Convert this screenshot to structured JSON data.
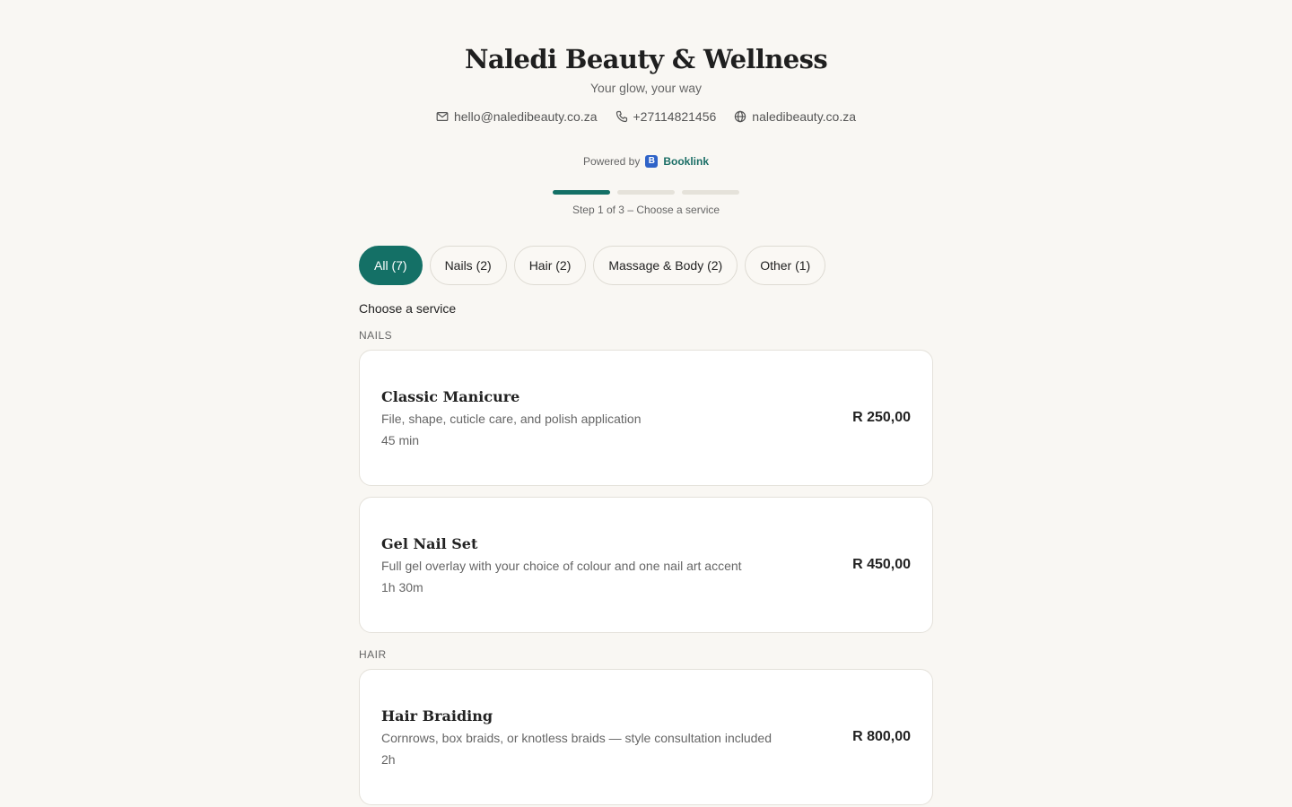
{
  "business": {
    "name": "Naledi Beauty & Wellness",
    "tagline": "Your glow, your way",
    "email": "hello@naledibeauty.co.za",
    "phone": "+27114821456",
    "website": "naledibeauty.co.za"
  },
  "powered_by": {
    "prefix": "Powered by",
    "logo_letter": "B",
    "brand": "Booklink"
  },
  "progress": {
    "current_step": 1,
    "total_steps": 3,
    "label": "Step 1 of 3 – Choose a service"
  },
  "filters": [
    {
      "label": "All (7)",
      "active": true
    },
    {
      "label": "Nails (2)",
      "active": false
    },
    {
      "label": "Hair (2)",
      "active": false
    },
    {
      "label": "Massage & Body (2)",
      "active": false
    },
    {
      "label": "Other (1)",
      "active": false
    }
  ],
  "section_title": "Choose a service",
  "categories": [
    {
      "label": "NAILS",
      "services": [
        {
          "name": "Classic Manicure",
          "description": "File, shape, cuticle care, and polish application",
          "duration": "45 min",
          "price": "R 250,00"
        },
        {
          "name": "Gel Nail Set",
          "description": "Full gel overlay with your choice of colour and one nail art accent",
          "duration": "1h 30m",
          "price": "R 450,00"
        }
      ]
    },
    {
      "label": "HAIR",
      "services": [
        {
          "name": "Hair Braiding",
          "description": "Cornrows, box braids, or knotless braids — style consultation included",
          "duration": "2h",
          "price": "R 800,00"
        }
      ]
    }
  ],
  "colors": {
    "accent": "#147066",
    "background": "#f9f7f3",
    "card": "#ffffff",
    "brand_logo": "#2f63c8"
  },
  "icons": {
    "email": "mail-icon",
    "phone": "phone-icon",
    "website": "globe-icon"
  }
}
